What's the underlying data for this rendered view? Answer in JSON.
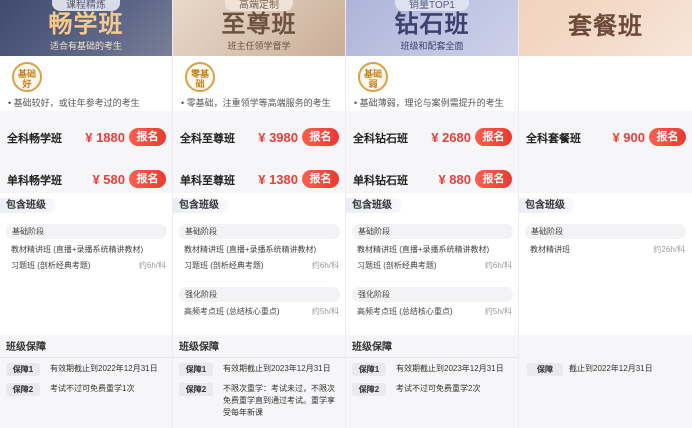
{
  "plans": [
    {
      "tag": "课程精炼",
      "title": "畅学班",
      "subtitle": "适合有基础的考生",
      "badge": "基础好",
      "level_desc": "• 基础较好，或往年参考过的考生",
      "prices": [
        {
          "name": "全科畅学班",
          "price": "¥ 1880",
          "button": "报名"
        },
        {
          "name": "单科畅学班",
          "price": "¥ 580",
          "button": "报名"
        }
      ],
      "classes_title": "包含班级",
      "stages": [
        {
          "name": "基础阶段",
          "items": [
            {
              "name": "教材精讲班 (直播+录播系统精讲教材)",
              "hours": ""
            },
            {
              "name": "习题班 (剖析经典考题)",
              "hours": "约6h/科"
            }
          ]
        }
      ],
      "guarantee_title": "班级保障",
      "guarantees": [
        {
          "label": "保障1",
          "text": "有效期截止到2022年12月31日"
        },
        {
          "label": "保障2",
          "text": "考试不过可免费重学1次"
        }
      ]
    },
    {
      "tag": "高端定制",
      "title": "至尊班",
      "subtitle": "班主任领学督学",
      "badge": "零基础",
      "level_desc": "• 零基础，注重领学等高端服务的考生",
      "prices": [
        {
          "name": "全科至尊班",
          "price": "¥ 3980",
          "button": "报名"
        },
        {
          "name": "单科至尊班",
          "price": "¥ 1380",
          "button": "报名"
        }
      ],
      "classes_title": "包含班级",
      "stages": [
        {
          "name": "基础阶段",
          "items": [
            {
              "name": "教材精讲班 (直播+录播系统精讲教材)",
              "hours": ""
            },
            {
              "name": "习题班 (剖析经典考题)",
              "hours": "约6h/科"
            }
          ]
        },
        {
          "name": "强化阶段",
          "items": [
            {
              "name": "高频考点班 (总结核心重点)",
              "hours": "约5h/科"
            }
          ]
        }
      ],
      "guarantee_title": "班级保障",
      "guarantees": [
        {
          "label": "保障1",
          "text": "有效期截止到2023年12月31日"
        },
        {
          "label": "保障2",
          "text": "不限次重学：考试未过，不限次免费重学直到通过考试。重学享受每年新课"
        }
      ]
    },
    {
      "tag": "销量TOP1",
      "title": "钻石班",
      "subtitle": "班级和配套全面",
      "badge": "基础弱",
      "level_desc": "• 基础薄弱，理论与案例需提升的考生",
      "prices": [
        {
          "name": "全科钻石班",
          "price": "¥ 2680",
          "button": "报名"
        },
        {
          "name": "单科钻石班",
          "price": "¥ 880",
          "button": "报名"
        }
      ],
      "classes_title": "包含班级",
      "stages": [
        {
          "name": "基础阶段",
          "items": [
            {
              "name": "教材精讲班 (直播+录播系统精讲教材)",
              "hours": ""
            },
            {
              "name": "习题班 (剖析经典考题)",
              "hours": "约6h/科"
            }
          ]
        },
        {
          "name": "强化阶段",
          "items": [
            {
              "name": "高频考点班 (总结核心重点)",
              "hours": "约5h/科"
            }
          ]
        }
      ],
      "guarantee_title": "班级保障",
      "guarantees": [
        {
          "label": "保障1",
          "text": "有效期截止到2023年12月31日"
        },
        {
          "label": "保障2",
          "text": "考试不过可免费重学2次"
        }
      ]
    },
    {
      "tag": "",
      "title": "套餐班",
      "subtitle": "",
      "badge": "",
      "level_desc": "",
      "prices": [
        {
          "name": "全科套餐班",
          "price": "¥ 900",
          "button": "报名"
        }
      ],
      "classes_title": "包含班级",
      "stages": [
        {
          "name": "基础阶段",
          "items": [
            {
              "name": "教材精讲班",
              "hours": "约26h/科"
            }
          ]
        }
      ],
      "guarantee_title": "",
      "guarantees": [
        {
          "label": "保障",
          "text": "截止到2022年12月31日"
        }
      ]
    }
  ]
}
